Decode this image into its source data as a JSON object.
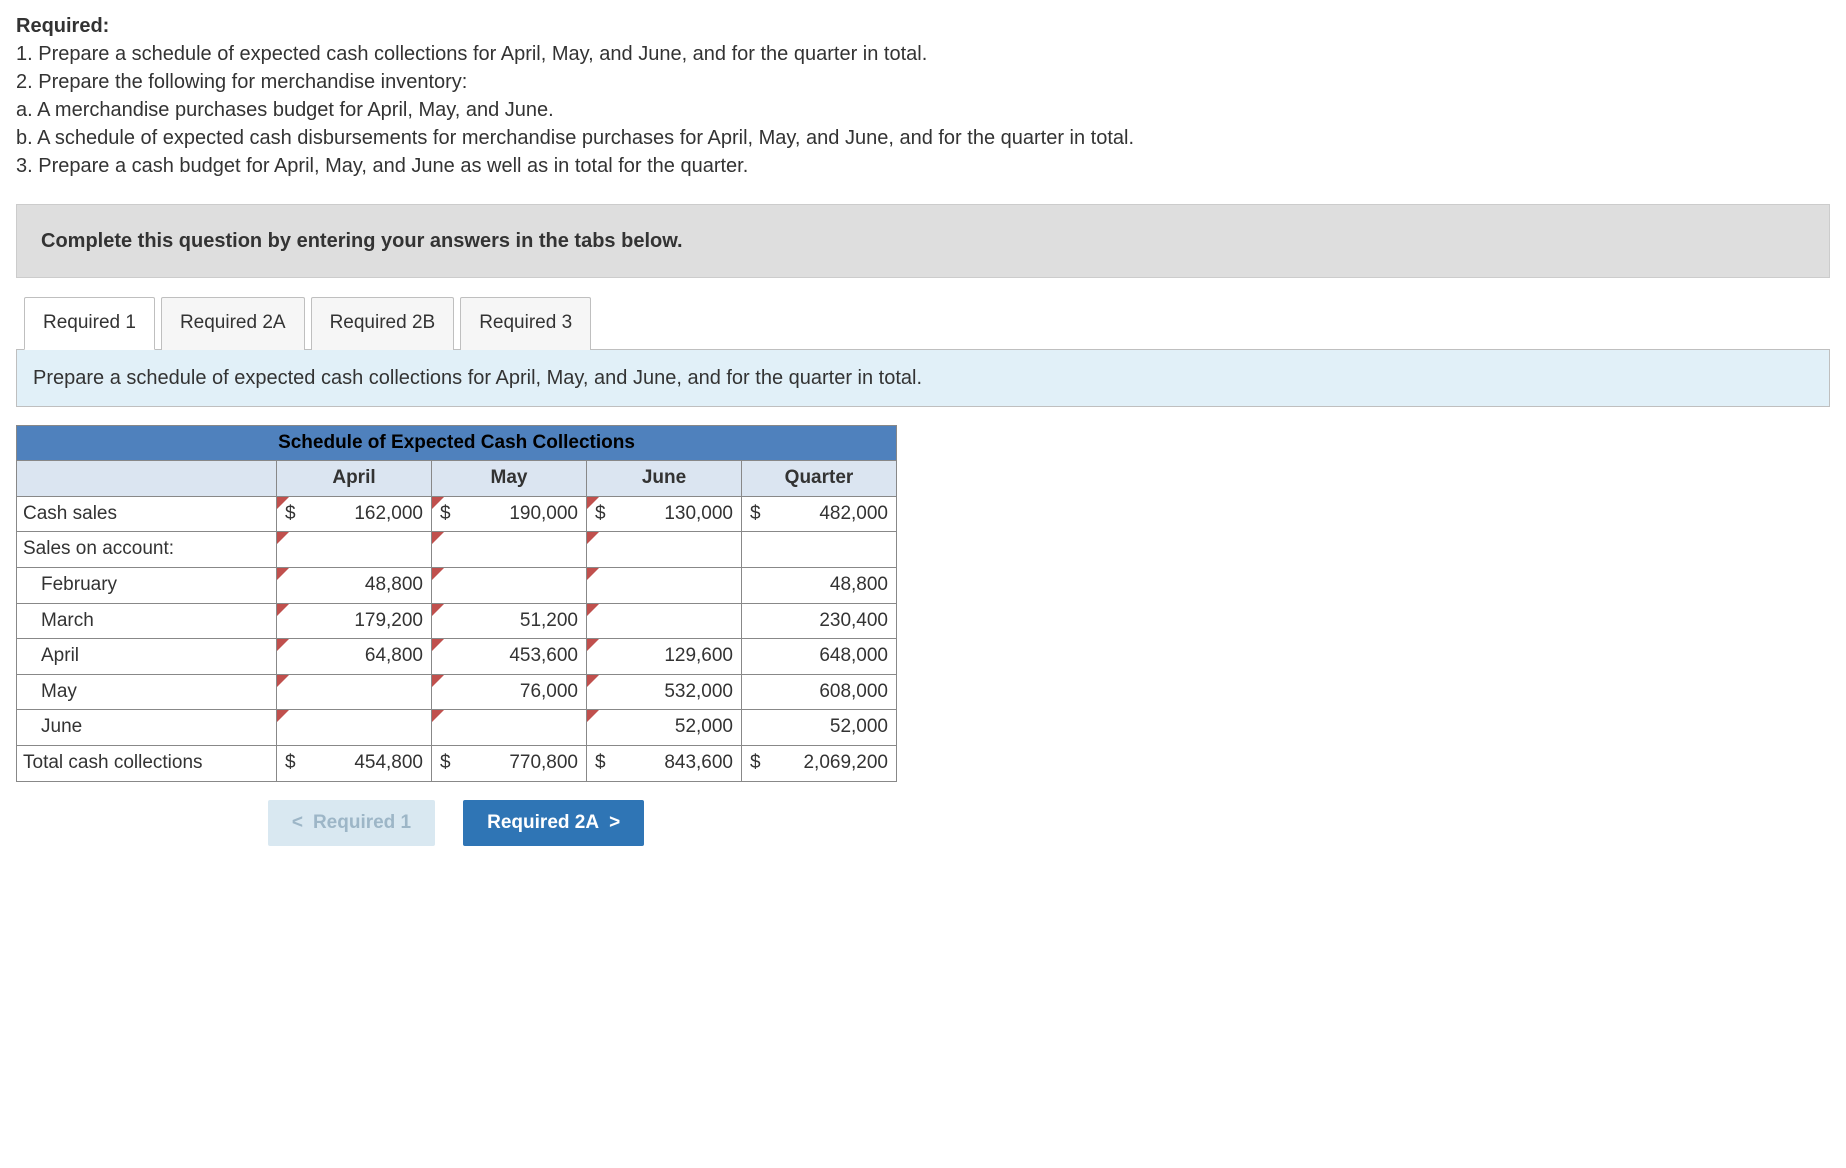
{
  "heading": "Required:",
  "instructions": [
    "1. Prepare a schedule of expected cash collections for April, May, and June, and for the quarter in total.",
    "2. Prepare the following for merchandise inventory:",
    "a. A merchandise purchases budget for April, May, and June.",
    "b. A schedule of expected cash disbursements for merchandise purchases for April, May, and June, and for the quarter in total.",
    "3. Prepare a cash budget for April, May, and June as well as in total for the quarter."
  ],
  "prompt": "Complete this question by entering your answers in the tabs below.",
  "tabs": {
    "t1": "Required 1",
    "t2a": "Required 2A",
    "t2b": "Required 2B",
    "t3": "Required 3"
  },
  "tab_desc": "Prepare a schedule of expected cash collections for April, May, and June, and for the quarter in total.",
  "table": {
    "title": "Schedule of Expected Cash Collections",
    "cols": {
      "c1": "April",
      "c2": "May",
      "c3": "June",
      "c4": "Quarter"
    }
  },
  "rows": {
    "cash_sales": {
      "label": "Cash sales",
      "april_cur": "$",
      "april": "162,000",
      "may_cur": "$",
      "may": "190,000",
      "june_cur": "$",
      "june": "130,000",
      "q_cur": "$",
      "q": "482,000"
    },
    "soa": {
      "label": "Sales on account:"
    },
    "feb": {
      "label": "February",
      "april": "48,800",
      "q": "48,800"
    },
    "mar": {
      "label": "March",
      "april": "179,200",
      "may": "51,200",
      "q": "230,400"
    },
    "apr": {
      "label": "April",
      "april": "64,800",
      "may": "453,600",
      "june": "129,600",
      "q": "648,000"
    },
    "mayr": {
      "label": "May",
      "may": "76,000",
      "june": "532,000",
      "q": "608,000"
    },
    "jun": {
      "label": "June",
      "june": "52,000",
      "q": "52,000"
    },
    "total": {
      "label": "Total cash collections",
      "april_cur": "$",
      "april": "454,800",
      "may_cur": "$",
      "may": "770,800",
      "june_cur": "$",
      "june": "843,600",
      "q_cur": "$",
      "q": "2,069,200"
    }
  },
  "nav": {
    "prev": "Required 1",
    "next": "Required 2A"
  },
  "glyph": {
    "left": "<",
    "right": ">"
  }
}
